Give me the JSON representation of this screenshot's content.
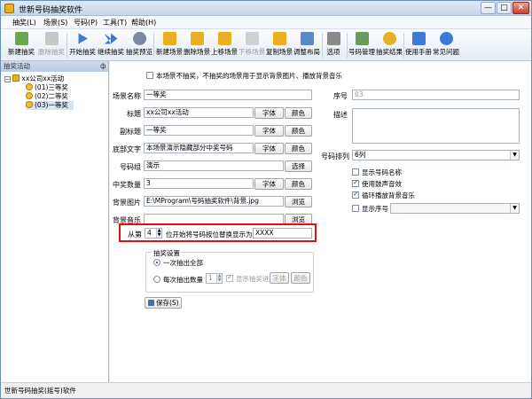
{
  "window": {
    "title": "世新号码抽奖软件",
    "btn_min": "—",
    "btn_max": "□",
    "btn_close": "✕"
  },
  "menu": [
    "抽奖(L)",
    "场景(S)",
    "号码(P)",
    "工具(T)",
    "帮助(H)"
  ],
  "toolbar": {
    "new_lottery": "新建抽奖",
    "delete_lottery": "删除抽奖",
    "start_lottery": "开始抽奖",
    "continue_lottery": "继续抽奖",
    "lottery_preview": "抽奖预览",
    "new_scene": "新建场景",
    "delete_scene": "删除场景",
    "move_up": "上移场景",
    "move_down": "下移场景",
    "copy_scene": "复制场景",
    "adjust_layout": "调整布局",
    "options": "选项",
    "number_mgmt": "号码管理",
    "lottery_result": "抽奖结果",
    "manual": "使用手册",
    "faq": "常见问题"
  },
  "panel": {
    "header": "抽奖活动",
    "pin": "ф",
    "tree": {
      "root": "xx公司xx活动",
      "items": [
        "(01)三等奖",
        "(02)二等奖",
        "(03)一等奖"
      ],
      "toggle": "−"
    }
  },
  "form": {
    "hint": "本场景不抽奖，不抽奖的场景用于显示背景图片、播放背景音乐",
    "scene_name_label": "场景名称",
    "scene_name": "一等奖",
    "title_label": "标题",
    "title_value": "xx公司xx活动",
    "subtitle_label": "副标题",
    "subtitle_value": "一等奖",
    "footer_label": "底部文字",
    "footer_value": "本场景演示隐藏部分中奖号码",
    "group_label": "号码组",
    "group_value": "演示",
    "count_label": "中奖数量",
    "count_value": "3",
    "bg_image_label": "背景图片",
    "bg_image_value": "E:\\MProgram\\号码抽奖软件\\背景.jpg",
    "bg_music_label": "背景音乐",
    "bg_music_value": "",
    "font_btn": "字体",
    "color_btn": "颜色",
    "select_btn": "选择",
    "browse_btn": "浏览",
    "from_label": "从第",
    "from_value": "4",
    "replace_label": "位开始将号码按位替换显示为",
    "replace_value": "XXXX",
    "settings_title": "抽奖设置",
    "all_once": "一次抽出全部",
    "each_count_label": "每次抽出数量",
    "each_count": "1",
    "show_progress": "显示抽奖进度",
    "save_btn": "保存(S)",
    "seq_label": "序号",
    "seq_value": "03",
    "desc_label": "描述",
    "arrange_label": "号码排列",
    "arrange_value": "6列",
    "show_name": "显示号码名称",
    "use_sound": "使用鼓声音效",
    "loop_music": "循环播放背景音乐",
    "show_seq": "显示序号"
  },
  "status": "世新号码抽奖(摇号)软件",
  "colors": {
    "highlight_border": "#e01010"
  }
}
